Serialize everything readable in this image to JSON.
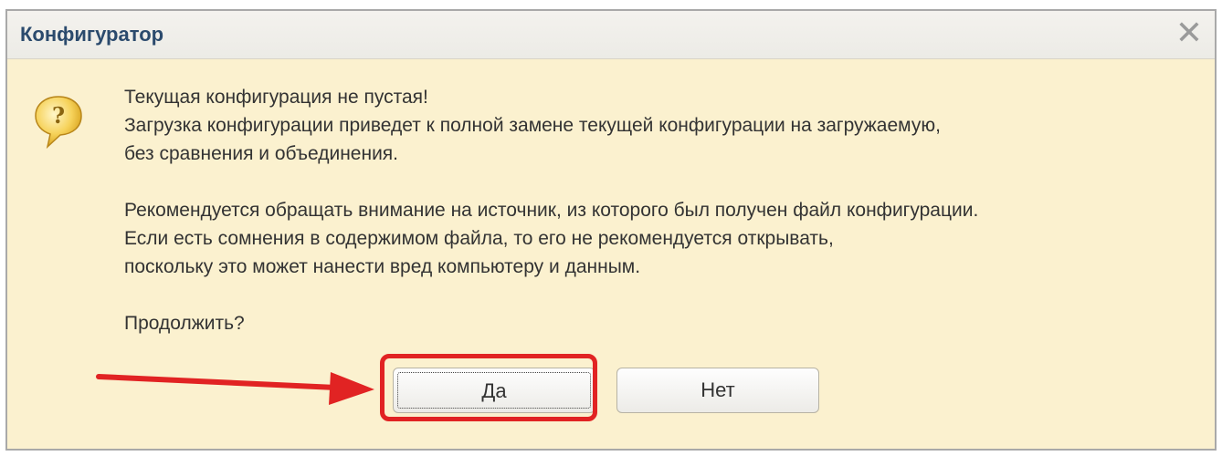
{
  "window": {
    "title": "Конфигуратор",
    "close_glyph": "✕"
  },
  "icon": "question-icon",
  "message": {
    "paragraph1": [
      "Текущая конфигурация не пустая!",
      "Загрузка конфигурации приведет к полной замене текущей конфигурации на загружаемую,",
      "без сравнения и объединения."
    ],
    "paragraph2": [
      "Рекомендуется обращать внимание на источник, из которого был получен файл конфигурации.",
      "Если есть сомнения в содержимом файла, то его не рекомендуется открывать,",
      "поскольку это может нанести вред компьютеру и данным."
    ],
    "question": "Продолжить?"
  },
  "buttons": {
    "yes": "Да",
    "no": "Нет"
  },
  "annotation": {
    "color": "#e12323"
  }
}
